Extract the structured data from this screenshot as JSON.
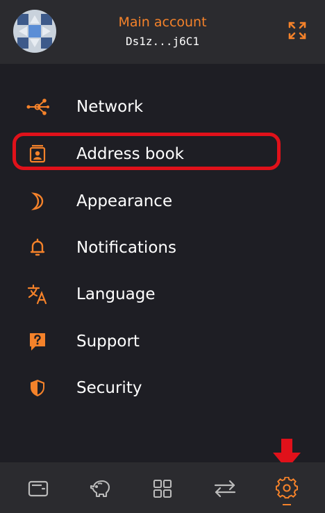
{
  "account": {
    "name": "Main account",
    "address": "Ds1z...j6C1"
  },
  "menu": {
    "items": [
      {
        "label": "Network",
        "icon": "network-icon"
      },
      {
        "label": "Address book",
        "icon": "address-book-icon"
      },
      {
        "label": "Appearance",
        "icon": "moon-icon"
      },
      {
        "label": "Notifications",
        "icon": "bell-icon"
      },
      {
        "label": "Language",
        "icon": "translate-icon"
      },
      {
        "label": "Support",
        "icon": "help-icon"
      },
      {
        "label": "Security",
        "icon": "shield-icon"
      }
    ]
  },
  "footer": {
    "tabs": [
      "wallet-icon",
      "piggy-bank-icon",
      "apps-grid-icon",
      "swap-icon",
      "settings-icon"
    ],
    "active_tab": "settings-icon"
  },
  "colors": {
    "accent": "#f5822a",
    "background": "#1e1e24",
    "panel": "#2b2b2f",
    "highlight": "#e0111a"
  }
}
